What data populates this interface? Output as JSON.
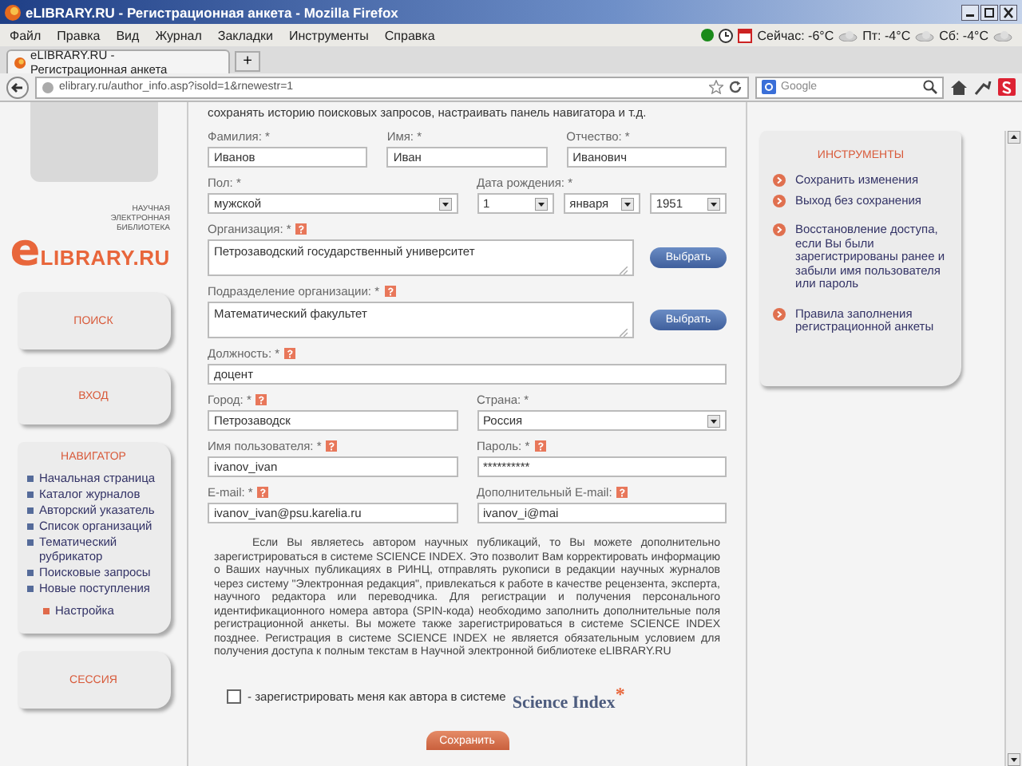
{
  "window": {
    "title": "eLIBRARY.RU - Регистрационная анкета - Mozilla Firefox"
  },
  "menu": [
    "Файл",
    "Правка",
    "Вид",
    "Журнал",
    "Закладки",
    "Инструменты",
    "Справка"
  ],
  "weather": [
    "Сейчас: -6°C",
    "Пт: -4°C",
    "Сб: -4°C"
  ],
  "tabs": [
    {
      "label": "eLIBRARY.RU - Регистрационная анкета",
      "selected": true
    }
  ],
  "new_tab": "+",
  "address": "elibrary.ru/author_info.asp?isold=1&rnewestr=1",
  "search": {
    "placeholder": "Google"
  },
  "logo": {
    "tagline": "НАУЧНАЯ ЭЛЕКТРОННАЯ БИБЛИОТЕКА",
    "letter": "e",
    "name": "LIBRARY.RU"
  },
  "sidebar": {
    "buttons": [
      "ПОИСК",
      "ВХОД"
    ],
    "navigator": {
      "title": "НАВИГАТОР",
      "items": [
        "Начальная страница",
        "Каталог журналов",
        "Авторский указатель",
        "Список организаций",
        "Тематический рубрикатор",
        "Поисковые запросы",
        "Новые поступления"
      ],
      "settings": "Настройка"
    },
    "session": "СЕССИЯ"
  },
  "form": {
    "intro": "сохранять историю поисковых запросов, настраивать панель навигатора и т.д.",
    "rows": [
      [
        {
          "kind": "text",
          "label": "Фамилия: *",
          "help": false,
          "value": "Иванов"
        },
        {
          "kind": "text",
          "label": "Имя: *",
          "help": false,
          "value": "Иван"
        },
        {
          "kind": "text",
          "label": "Отчество: *",
          "help": false,
          "value": "Иванович"
        }
      ],
      [
        {
          "kind": "select",
          "label": "Пол: *",
          "help": false,
          "value": "мужской"
        },
        {
          "kind": "date",
          "label": "Дата рождения: *",
          "help": false,
          "values": [
            "1",
            "января",
            "1951"
          ]
        }
      ],
      [
        {
          "kind": "textarea",
          "label": "Организация: *",
          "help": true,
          "value": "Петрозаводский государственный университет",
          "button": "Выбрать"
        }
      ],
      [
        {
          "kind": "textarea",
          "label": "Подразделение организации: *",
          "help": true,
          "value": "Математический факультет",
          "button": "Выбрать"
        }
      ],
      [
        {
          "kind": "text",
          "label": "Должность: *",
          "help": true,
          "value": "доцент"
        }
      ],
      [
        {
          "kind": "text",
          "label": "Город: *",
          "help": true,
          "value": "Петрозаводск"
        },
        {
          "kind": "select",
          "label": "Страна: *",
          "help": false,
          "value": "Россия"
        }
      ],
      [
        {
          "kind": "text",
          "label": "Имя пользователя: *",
          "help": true,
          "value": "ivanov_ivan"
        },
        {
          "kind": "text",
          "label": "Пароль: *",
          "help": true,
          "value": "**********"
        }
      ],
      [
        {
          "kind": "text",
          "label": "E-mail: *",
          "help": true,
          "value": "ivanov_ivan@psu.karelia.ru"
        },
        {
          "kind": "text",
          "label": "Дополнительный E-mail:",
          "help": true,
          "value": "ivanov_i@mai"
        }
      ]
    ],
    "note": "Если Вы являетесь автором научных публикаций, то Вы можете дополнительно зарегистрироваться в системе SCIENCE INDEX. Это позволит Вам корректировать информацию о Ваших научных публикациях в РИНЦ, отправлять рукописи в редакции научных журналов через систему \"Электронная редакция\", привлекаться к работе в качестве рецензента, эксперта, научного редактора или переводчика. Для регистрации и получения персонального идентификационного номера автора (SPIN-кода) необходимо заполнить дополнительные поля регистрационной анкеты. Вы можете также зарегистрироваться в системе SCIENCE INDEX позднее. Регистрация в системе SCIENCE INDEX не является обязательным условием для получения доступа к полным текстам в Научной электронной библиотеке eLIBRARY.RU",
    "author_checkbox": {
      "checked": false,
      "label": "- зарегистрировать меня как автора в системе",
      "brand": "Science Index",
      "mark": "*"
    },
    "save": "Сохранить"
  },
  "tools": {
    "title": "ИНСТРУМЕНТЫ",
    "items": [
      "Сохранить изменения",
      "Выход без сохранения",
      "Восстановление доступа, если Вы были зарегистрированы ранее и забыли имя пользователя или пароль",
      "Правила заполнения регистрационной анкеты"
    ]
  }
}
